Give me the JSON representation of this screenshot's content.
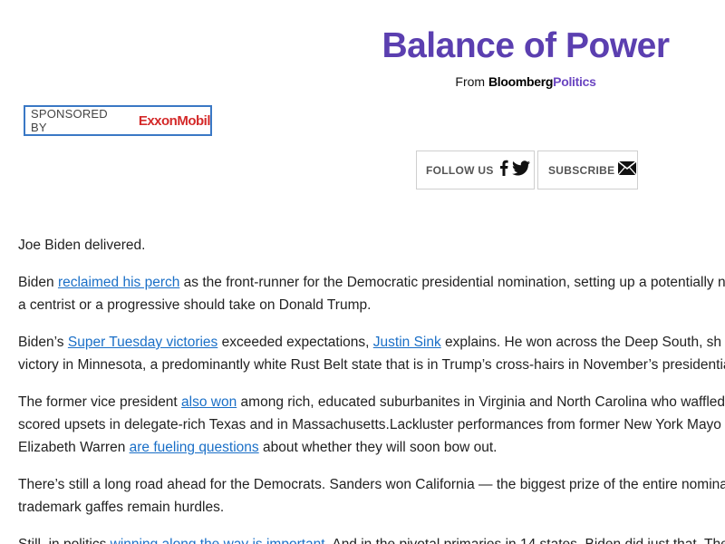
{
  "header": {
    "title": "Balance of Power",
    "from_prefix": "From ",
    "brand_bloomberg": "Bloomberg",
    "brand_politics": "Politics"
  },
  "sponsor": {
    "label": "SPONSORED BY",
    "logo_text": "ExxonMobil"
  },
  "actions": {
    "follow_label": "FOLLOW US",
    "subscribe_label": "SUBSCRIBE"
  },
  "article": {
    "p1": "Joe Biden delivered.",
    "p2": {
      "a": "Biden ",
      "link1": "reclaimed his perch",
      "b": " as the front-runner for the Democratic presidential nomination, setting up a potentially n",
      "c": "a centrist or a progressive should take on Donald Trump."
    },
    "p3": {
      "a": "Biden’s ",
      "link1": "Super Tuesday victories",
      "b": " exceeded expectations, ",
      "link2": "Justin Sink",
      "c": " explains. He won across the Deep South, sh",
      "d": "victory in Minnesota, a predominantly white Rust Belt state that is in Trump’s cross-hairs in November’s presidentia"
    },
    "p4": {
      "a": "The former vice president ",
      "link1": "also won",
      "b": " among rich, educated suburbanites in Virginia and North Carolina who waffled",
      "c": "scored upsets in delegate-rich Texas and in Massachusetts.Lackluster performances from former New York Mayo",
      "d": "Elizabeth Warren ",
      "link2": "are fueling questions",
      "e": " about whether they will soon bow out."
    },
    "p5": {
      "a": "There’s still a long road ahead for the Democrats. Sanders won California — the biggest prize of the entire nomina",
      "b": "trademark gaffes remain hurdles."
    },
    "p6": {
      "a": "Still, in politics ",
      "link1": "winning along the way is important",
      "b": ". And in the pivotal primaries in 14 states, Biden did just that. The"
    }
  },
  "colors": {
    "title_purple": "#5b3fb0",
    "link_blue": "#1a6fc7",
    "sponsor_border": "#3a78c5",
    "exxon_red": "#d42a2a"
  }
}
